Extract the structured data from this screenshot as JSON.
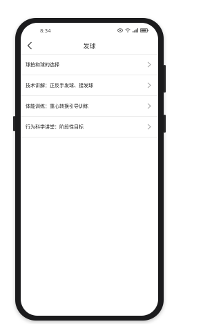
{
  "status_bar": {
    "time": "8:34",
    "battery_icon": "battery-icon",
    "wifi_icon": "wifi-icon",
    "signal_icon": "signal-icon",
    "eye_icon": "eye-icon"
  },
  "header": {
    "title": "发球",
    "back_icon": "chevron-left-icon"
  },
  "list": {
    "items": [
      {
        "label": "球拍和球的选择"
      },
      {
        "label": "技术讲解：正反手发球、接发球"
      },
      {
        "label": "体能训练：重心转换引导训练"
      },
      {
        "label": "行为科学讲堂：阶段性目标"
      }
    ]
  },
  "colors": {
    "phone_frame": "#1b1b1d",
    "screen_bg": "#ffffff",
    "text": "#222222",
    "divider": "#ececec",
    "chevron": "#9a9a9a"
  }
}
